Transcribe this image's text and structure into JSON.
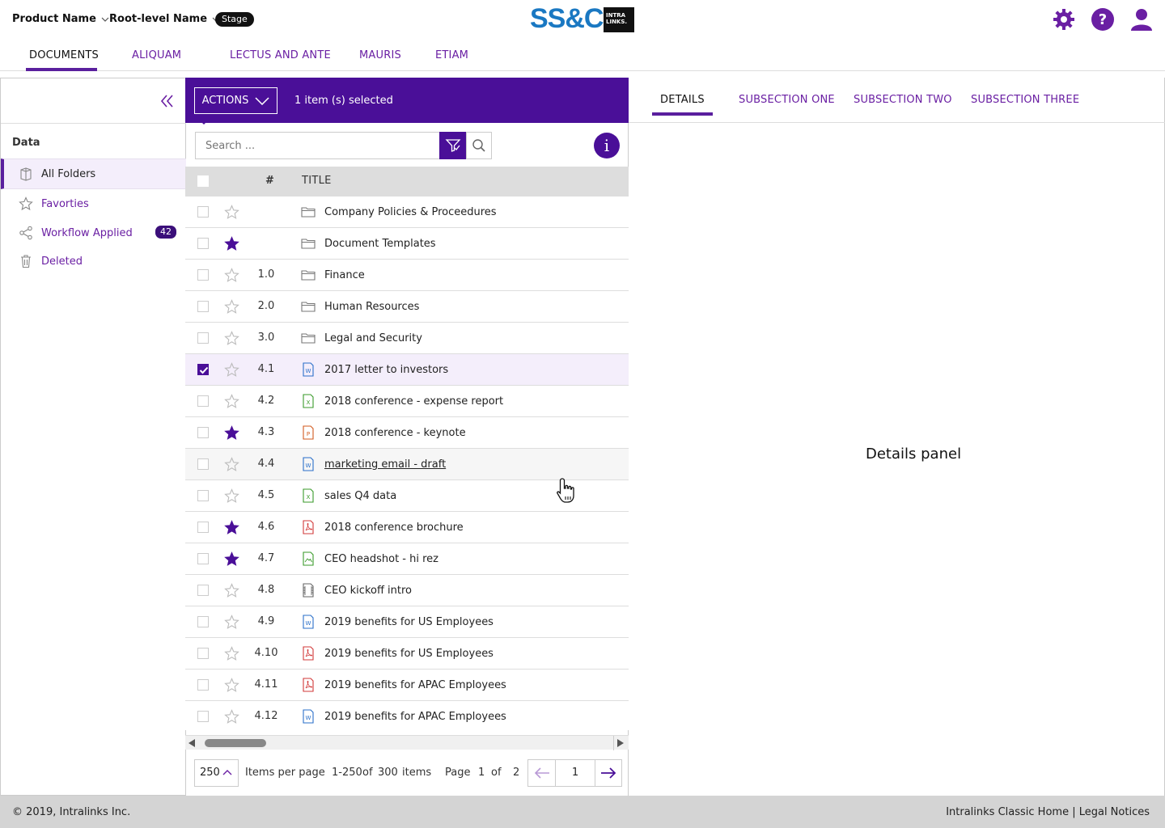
{
  "header": {
    "product_name": "Product Name",
    "root_name": "Root-level Name",
    "stage_badge": "Stage",
    "logo_ssc": "SS&C",
    "logo_intralinks": "INTRA LINKS.",
    "icons": [
      "gear-icon",
      "help-icon",
      "user-icon"
    ]
  },
  "main_tabs": [
    {
      "label": "DOCUMENTS",
      "active": true
    },
    {
      "label": "ALIQUAM"
    },
    {
      "label": "LECTUS AND ANTE"
    },
    {
      "label": "MAURIS"
    },
    {
      "label": "ETIAM"
    }
  ],
  "sidebar": {
    "heading": "Data",
    "items": [
      {
        "label": "All Folders",
        "icon": "folders-icon",
        "active": true
      },
      {
        "label": "Favorties",
        "icon": "star-icon"
      },
      {
        "label": "Workflow Applied",
        "icon": "share-icon",
        "badge": "42"
      },
      {
        "label": "Deleted",
        "icon": "trash-icon"
      }
    ]
  },
  "toolbar": {
    "actions_label": "ACTIONS",
    "selected_text": "1 item (s) selected",
    "search_placeholder": "Search ...",
    "info_label": "i"
  },
  "grid": {
    "columns": {
      "num": "#",
      "title": "TITLE"
    },
    "rows": [
      {
        "num": "",
        "title": "Company Policies & Proceedures",
        "type": "folder",
        "starred": false
      },
      {
        "num": "",
        "title": "Document Templates",
        "type": "folder",
        "starred": true
      },
      {
        "num": "1.0",
        "title": "Finance",
        "type": "folder",
        "starred": false
      },
      {
        "num": "2.0",
        "title": "Human Resources",
        "type": "folder",
        "starred": false
      },
      {
        "num": "3.0",
        "title": "Legal and Security",
        "type": "folder",
        "starred": false
      },
      {
        "num": "4.1",
        "title": "2017 letter to investors",
        "type": "word",
        "starred": false,
        "checked": true
      },
      {
        "num": "4.2",
        "title": "2018 conference - expense report",
        "type": "excel",
        "starred": false
      },
      {
        "num": "4.3",
        "title": "2018 conference - keynote",
        "type": "powerpoint",
        "starred": true
      },
      {
        "num": "4.4",
        "title": "marketing email - draft",
        "type": "word",
        "starred": false,
        "hover": true
      },
      {
        "num": "4.5",
        "title": "sales Q4 data",
        "type": "excel",
        "starred": false
      },
      {
        "num": "4.6",
        "title": "2018 conference brochure",
        "type": "pdf",
        "starred": true
      },
      {
        "num": "4.7",
        "title": "CEO headshot - hi rez",
        "type": "image",
        "starred": true
      },
      {
        "num": "4.8",
        "title": "CEO kickoff intro",
        "type": "video",
        "starred": false
      },
      {
        "num": "4.9",
        "title": "2019 benefits for US Employees",
        "type": "word",
        "starred": false
      },
      {
        "num": "4.10",
        "title": "2019 benefits for US Employees",
        "type": "pdf",
        "starred": false
      },
      {
        "num": "4.11",
        "title": "2019 benefits for APAC Employees",
        "type": "pdf",
        "starred": false
      },
      {
        "num": "4.12",
        "title": "2019 benefits for APAC Employees",
        "type": "word",
        "starred": false
      }
    ]
  },
  "pager": {
    "per_page": "250",
    "items_per_page_label": "Items per page",
    "range": "1-250",
    "of_label": "of",
    "total": "300",
    "items_label": "items",
    "page_label": "Page",
    "page": "1",
    "of2_label": "of",
    "total_pages": "2",
    "current_input": "1"
  },
  "details": {
    "tabs": [
      {
        "label": "DETAILS",
        "active": true
      },
      {
        "label": "SUBSECTION ONE"
      },
      {
        "label": "SUBSECTION TWO"
      },
      {
        "label": "SUBSECTION THREE"
      }
    ],
    "panel_label": "Details panel"
  },
  "footer": {
    "copyright": "© 2019, Intralinks Inc.",
    "links": "Intralinks Classic Home  |  Legal Notices"
  },
  "colors": {
    "accent": "#4a0f98",
    "link": "#6a1fa3",
    "logo_blue": "#1a78c2"
  }
}
